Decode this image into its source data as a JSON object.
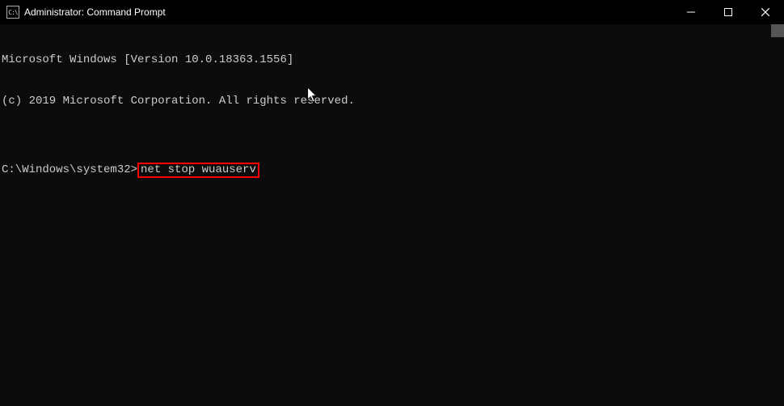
{
  "titlebar": {
    "icon_label": "C:\\",
    "title": "Administrator: Command Prompt"
  },
  "terminal": {
    "line1": "Microsoft Windows [Version 10.0.18363.1556]",
    "line2": "(c) 2019 Microsoft Corporation. All rights reserved.",
    "blank": "",
    "prompt": "C:\\Windows\\system32>",
    "command": "net stop wuauserv"
  }
}
